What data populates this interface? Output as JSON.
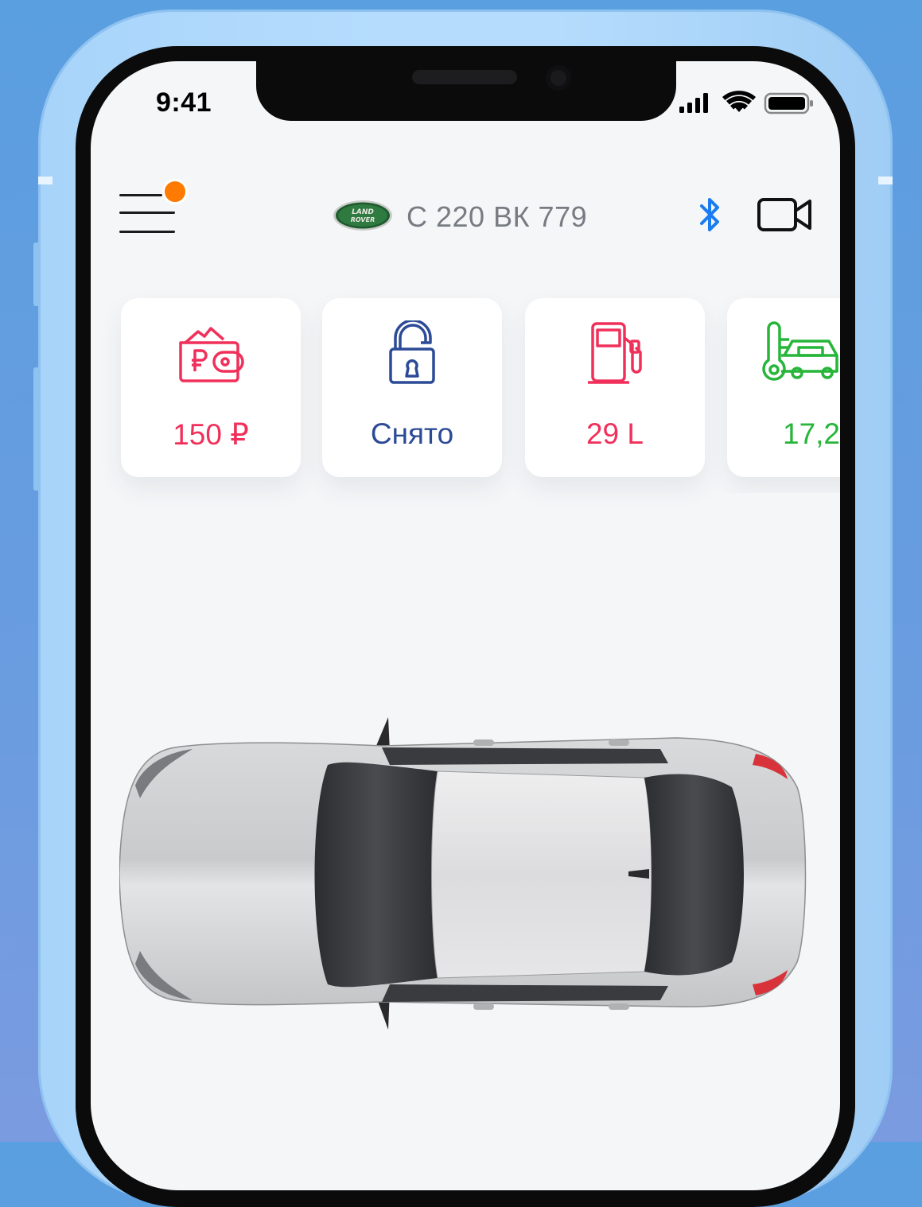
{
  "status_bar": {
    "time": "9:41"
  },
  "header": {
    "brand_logo_text": "LAND ROVER",
    "plate": "С 220 ВК 779"
  },
  "cards": [
    {
      "icon": "wallet-icon",
      "value": "150 ₽",
      "color": "#f0305a"
    },
    {
      "icon": "open-lock-icon",
      "value": "Снято",
      "color": "#2c4a96"
    },
    {
      "icon": "fuel-pump-icon",
      "value": "29 L",
      "color": "#f0305a"
    },
    {
      "icon": "car-temperature-icon",
      "value": "17,2",
      "color": "#27b53a"
    }
  ],
  "colors": {
    "notification": "#ff7a00",
    "bluetooth": "#1a7cf0",
    "frame": "#b5dcfd"
  }
}
